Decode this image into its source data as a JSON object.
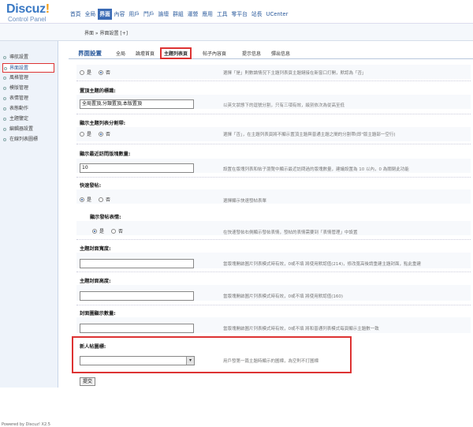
{
  "logo": {
    "main": "Discuz",
    "bang": "!",
    "sub": "Control Panel"
  },
  "nav": [
    "首頁",
    "全局",
    "界面",
    "內容",
    "用戶",
    "門戶",
    "論壇",
    "群組",
    "運營",
    "應用",
    "工具",
    "零平台",
    "站長",
    "UCenter"
  ],
  "breadcrumb": "界面 » 界面設置  [+]",
  "sidebar": [
    {
      "label": "導航設置",
      "active": false
    },
    {
      "label": "界面設置",
      "active": true
    },
    {
      "label": "風格管理",
      "active": false
    },
    {
      "label": "模版管理",
      "active": false
    },
    {
      "label": "表情管理",
      "active": false
    },
    {
      "label": "表態動作",
      "active": false
    },
    {
      "label": "主題鑒定",
      "active": false
    },
    {
      "label": "編輯器設置",
      "active": false
    },
    {
      "label": "在線列表圖標",
      "active": false
    }
  ],
  "powered": "Powered by Discuz! X2.5",
  "main": {
    "title": "界面設置",
    "subtabs": [
      "全局",
      "論壇首頁",
      "主題列表頁",
      "帖子內容頁",
      "提示信息",
      "彈出信息"
    ],
    "r1": {
      "yes": "是",
      "no": "否",
      "tip": "選擇「是」則數論情況下主題列表頁主題鏈接在新窗口打開，默認為「否」"
    },
    "s2": {
      "label": "置頂主題的標識:",
      "value": "全局置頂,分類置頂,本版置頂",
      "tip": "以英文狀態下的逗號分割，只有三項有效，級別依次為從高至低"
    },
    "s3": {
      "label": "顯示主題列表分割帶:",
      "yes": "是",
      "no": "否",
      "tip": "選擇「否」，在主題列表頁將不顯示置頂主題與普通主題之間的分割帶(即\"版主題部一空行)"
    },
    "s4": {
      "label": "顯示最近訪問版塊數量:",
      "value": "10",
      "tip": "設置在版塊列表和帖子瀏覽中顯示最近訪問過的版塊數量，建議設置為 10 以內，0 為關閉此功能"
    },
    "s5": {
      "label": "快速發帖:",
      "yes": "是",
      "no": "否",
      "tip": "選擇顯示快速發帖表單"
    },
    "s6": {
      "label": "顯示發帖表情:",
      "yes": "是",
      "no": "否",
      "tip": "在快速發帖右側顯示發帖表情，發帖的表情需要到「表情管理」中設置"
    },
    "s7": {
      "label": "主題封面寬度:",
      "value": "",
      "tip": "當版塊開啟圖片列表模式時有效，0或不填 將使用默認值(214)，修改寬高後請重建主題封面，",
      "tip2": "點此重建"
    },
    "s8": {
      "label": "主題封面高度:",
      "value": "",
      "tip": "當版塊開啟圖片列表模式時有效，0或不填 將使用默認值(160)"
    },
    "s9": {
      "label": "封面圖顯示數量:",
      "value": "",
      "tip": "當版塊開啟圖片列表模式時有效，0或不填 將和普通列表模式每頁顯示主題數一致"
    },
    "s10": {
      "label": "新人帖圖標:",
      "value": "",
      "tip": "用戶發第一篇主題時顯示的圖標，為空則不打圖標"
    },
    "submit": "提交"
  }
}
